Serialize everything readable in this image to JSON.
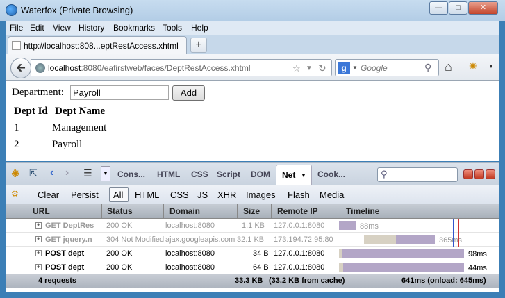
{
  "window": {
    "title": "Waterfox (Private Browsing)"
  },
  "menu": [
    "File",
    "Edit",
    "View",
    "History",
    "Bookmarks",
    "Tools",
    "Help"
  ],
  "tab": {
    "label": "http://localhost:808...eptRestAccess.xhtml",
    "new_tab": "+"
  },
  "nav": {
    "url_host": "localhost",
    "url_rest": ":8080/eafirstweb/faces/DeptRestAccess.xhtml",
    "search_placeholder": "Google",
    "search_engine": "g"
  },
  "page": {
    "dept_label": "Department:",
    "dept_value": "Payroll",
    "add_label": "Add",
    "table": {
      "headers": [
        "Dept Id",
        "Dept Name"
      ],
      "rows": [
        [
          "1",
          "Management"
        ],
        [
          "2",
          "Payroll"
        ]
      ]
    }
  },
  "firebug": {
    "tabs": [
      "Cons...",
      "HTML",
      "CSS",
      "Script",
      "DOM",
      "Net",
      "Cook..."
    ],
    "filters": [
      "Clear",
      "Persist",
      "All",
      "HTML",
      "CSS",
      "JS",
      "XHR",
      "Images",
      "Flash",
      "Media"
    ],
    "columns": [
      "URL",
      "Status",
      "Domain",
      "Size",
      "Remote IP",
      "Timeline"
    ],
    "requests": [
      {
        "url": "GET DeptRes",
        "status": "200 OK",
        "domain": "localhost:8080",
        "size": "1.1 KB",
        "ip": "127.0.0.1:8080",
        "time": "88ms",
        "cached": true
      },
      {
        "url": "GET jquery.n",
        "status": "304 Not Modified",
        "domain": "ajax.googleapis.com",
        "size": "32.1 KB",
        "ip": "173.194.72.95:80",
        "time": "365ms",
        "cached": true
      },
      {
        "url": "POST dept",
        "status": "200 OK",
        "domain": "localhost:8080",
        "size": "34 B",
        "ip": "127.0.0.1:8080",
        "time": "98ms",
        "cached": false
      },
      {
        "url": "POST dept",
        "status": "200 OK",
        "domain": "localhost:8080",
        "size": "64 B",
        "ip": "127.0.0.1:8080",
        "time": "44ms",
        "cached": false
      }
    ],
    "summary": {
      "count": "4 requests",
      "size": "33.3 KB",
      "cache": "(33.2 KB from cache)",
      "timing": "641ms (onload: 645ms)"
    }
  }
}
